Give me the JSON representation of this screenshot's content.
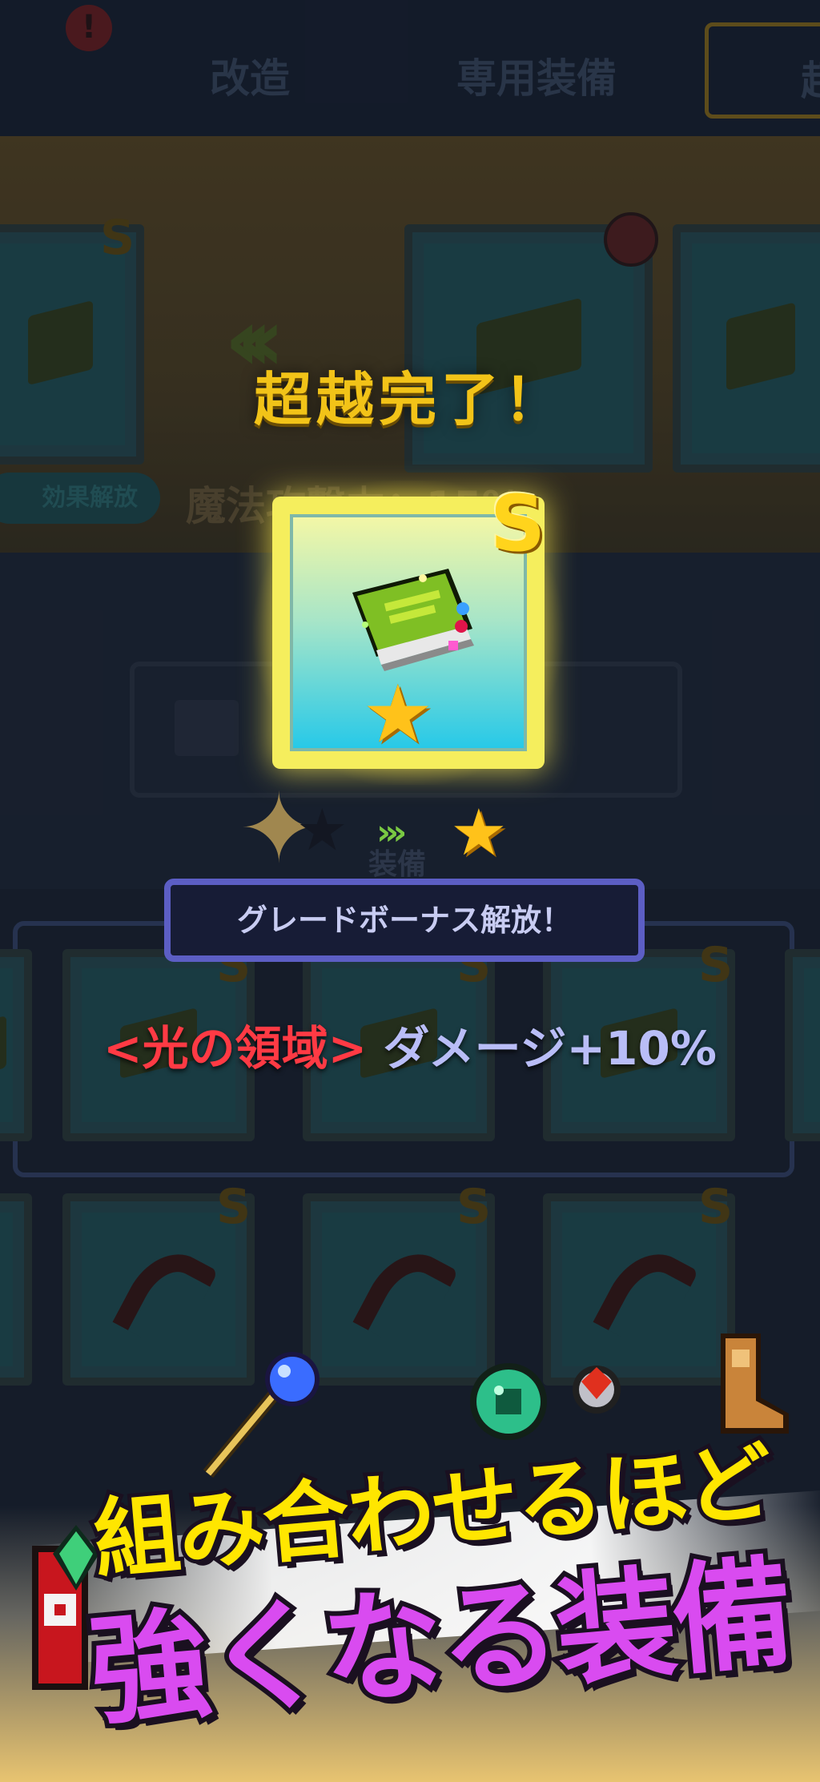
{
  "tabs": {
    "left_partial": "",
    "modify": "改造",
    "exclusive_equipment": "専用装備",
    "right_partial": "超"
  },
  "notice_badge": "!",
  "background": {
    "effect_pill": "効果解放",
    "stat_line": "魔法攻撃力：15%",
    "equip_label": "装備"
  },
  "modal": {
    "title": "超越完了！",
    "grade": "S",
    "star_before": "★",
    "arrows": "›››",
    "star_after": "★",
    "bonus_label": "グレードボーナス解放！",
    "bonus_skill": "<光の領域>",
    "bonus_effect": " ダメージ+10%"
  },
  "promo": {
    "line1": "組み合わせるほど",
    "line2": "強くなる装備"
  },
  "colors": {
    "title_gold": "#f2c318",
    "skill_red": "#ff3a44",
    "effect_lavender": "#b9bdf7",
    "promo_yellow": "#ffe600",
    "promo_purple": "#d94bf0"
  }
}
